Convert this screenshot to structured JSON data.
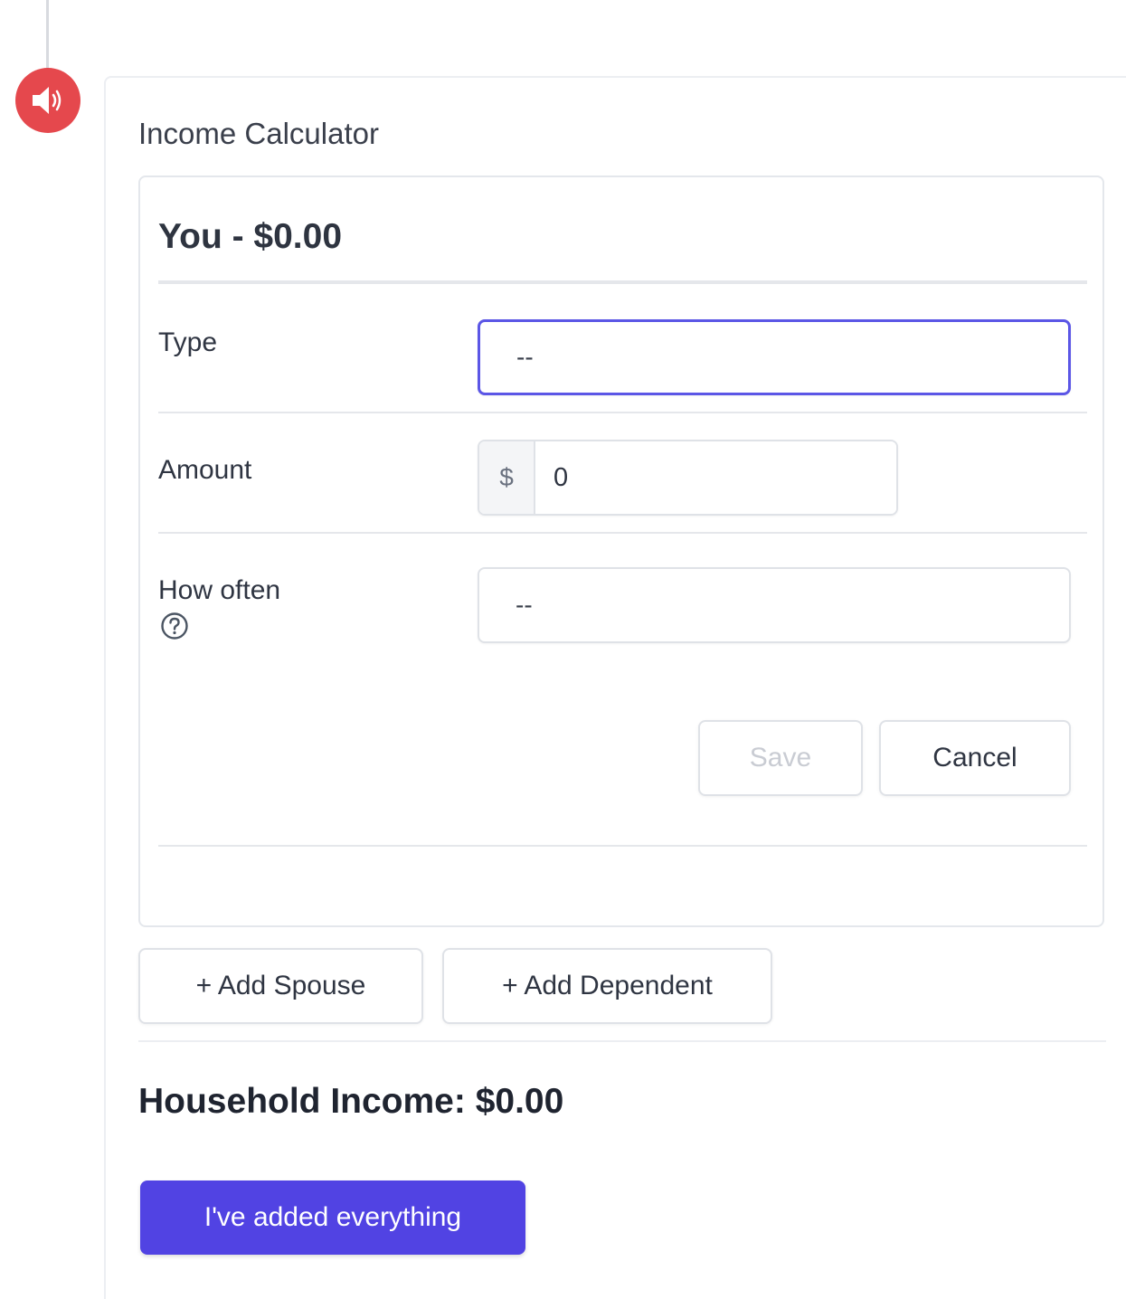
{
  "audio": {
    "icon": "speaker-icon",
    "color": "#e5484d"
  },
  "calculator": {
    "title": "Income Calculator",
    "person": {
      "heading": "You - $0.00",
      "fields": {
        "type": {
          "label": "Type",
          "value": "--"
        },
        "amount": {
          "label": "Amount",
          "currency_symbol": "$",
          "value": "0"
        },
        "frequency": {
          "label": "How often",
          "value": "--",
          "help_icon": "question-circle-icon"
        }
      },
      "actions": {
        "save_label": "Save",
        "cancel_label": "Cancel"
      }
    },
    "add_buttons": {
      "spouse_label": "+ Add Spouse",
      "dependent_label": "+ Add Dependent"
    },
    "household_total": "Household Income: $0.00",
    "submit_label": "I've added everything"
  },
  "colors": {
    "accent": "#5143e3",
    "focus_border": "#5b56e6",
    "audio_red": "#e5484d"
  }
}
